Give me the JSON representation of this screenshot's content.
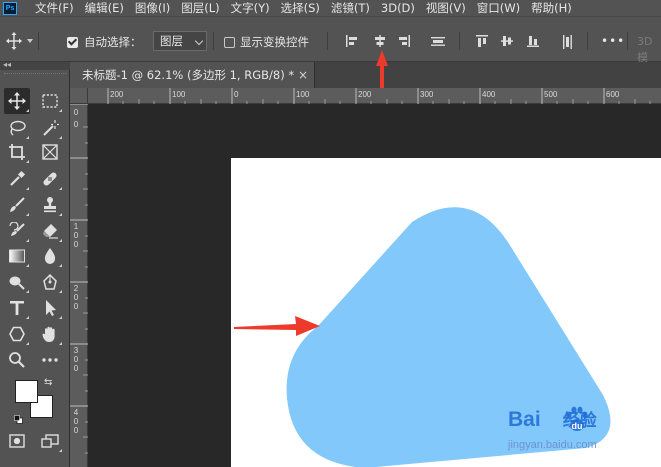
{
  "app": {
    "logo_text": "Ps",
    "menu": [
      "文件(F)",
      "编辑(E)",
      "图像(I)",
      "图层(L)",
      "文字(Y)",
      "选择(S)",
      "滤镜(T)",
      "3D(D)",
      "视图(V)",
      "窗口(W)",
      "帮助(H)"
    ]
  },
  "options_bar": {
    "auto_select_label": "自动选择：",
    "auto_select_checked": true,
    "auto_select_target": "图层",
    "show_transform_label": "显示变换控件",
    "show_transform_checked": false,
    "more_label": "•••",
    "mode_3d_label": "3D 模"
  },
  "document_tab": {
    "title": "未标题-1 @ 62.1% (多边形 1, RGB/8) *",
    "close_label": "×"
  },
  "rulers": {
    "horizontal": [
      "200",
      "100",
      "0",
      "100",
      "200",
      "300",
      "400",
      "500",
      "600"
    ],
    "vertical": [
      "0",
      "0",
      "1\n0\n0",
      "2\n0\n0",
      "3\n0\n0",
      "4\n0\n0"
    ]
  },
  "canvas": {
    "background": "#282828",
    "document_color": "#ffffff",
    "shape_color": "#82c8fa"
  },
  "colors": {
    "foreground": "#ffffff",
    "background": "#ffffff",
    "annotation": "#ee3a2c",
    "panel": "#535353"
  },
  "icons": {
    "move": "move-icon",
    "marquee": "rect-marquee-icon",
    "lasso": "lasso-icon",
    "magic_wand": "magic-wand-icon",
    "crop": "crop-icon",
    "frame": "frame-icon",
    "eyedropper": "eyedropper-icon",
    "healing": "healing-brush-icon",
    "brush": "brush-icon",
    "stamp": "clone-stamp-icon",
    "history_brush": "history-brush-icon",
    "eraser": "eraser-icon",
    "gradient": "gradient-icon",
    "blur": "blur-icon",
    "dodge": "dodge-icon",
    "pen": "pen-icon",
    "type": "type-icon",
    "path_select": "path-selection-icon",
    "shape": "polygon-shape-icon",
    "hand": "hand-icon",
    "zoom": "zoom-icon",
    "more": "more-tools-icon"
  },
  "watermark": {
    "logo": "Bai",
    "logo_tail": "经验",
    "url": "jingyan.baidu.com"
  }
}
